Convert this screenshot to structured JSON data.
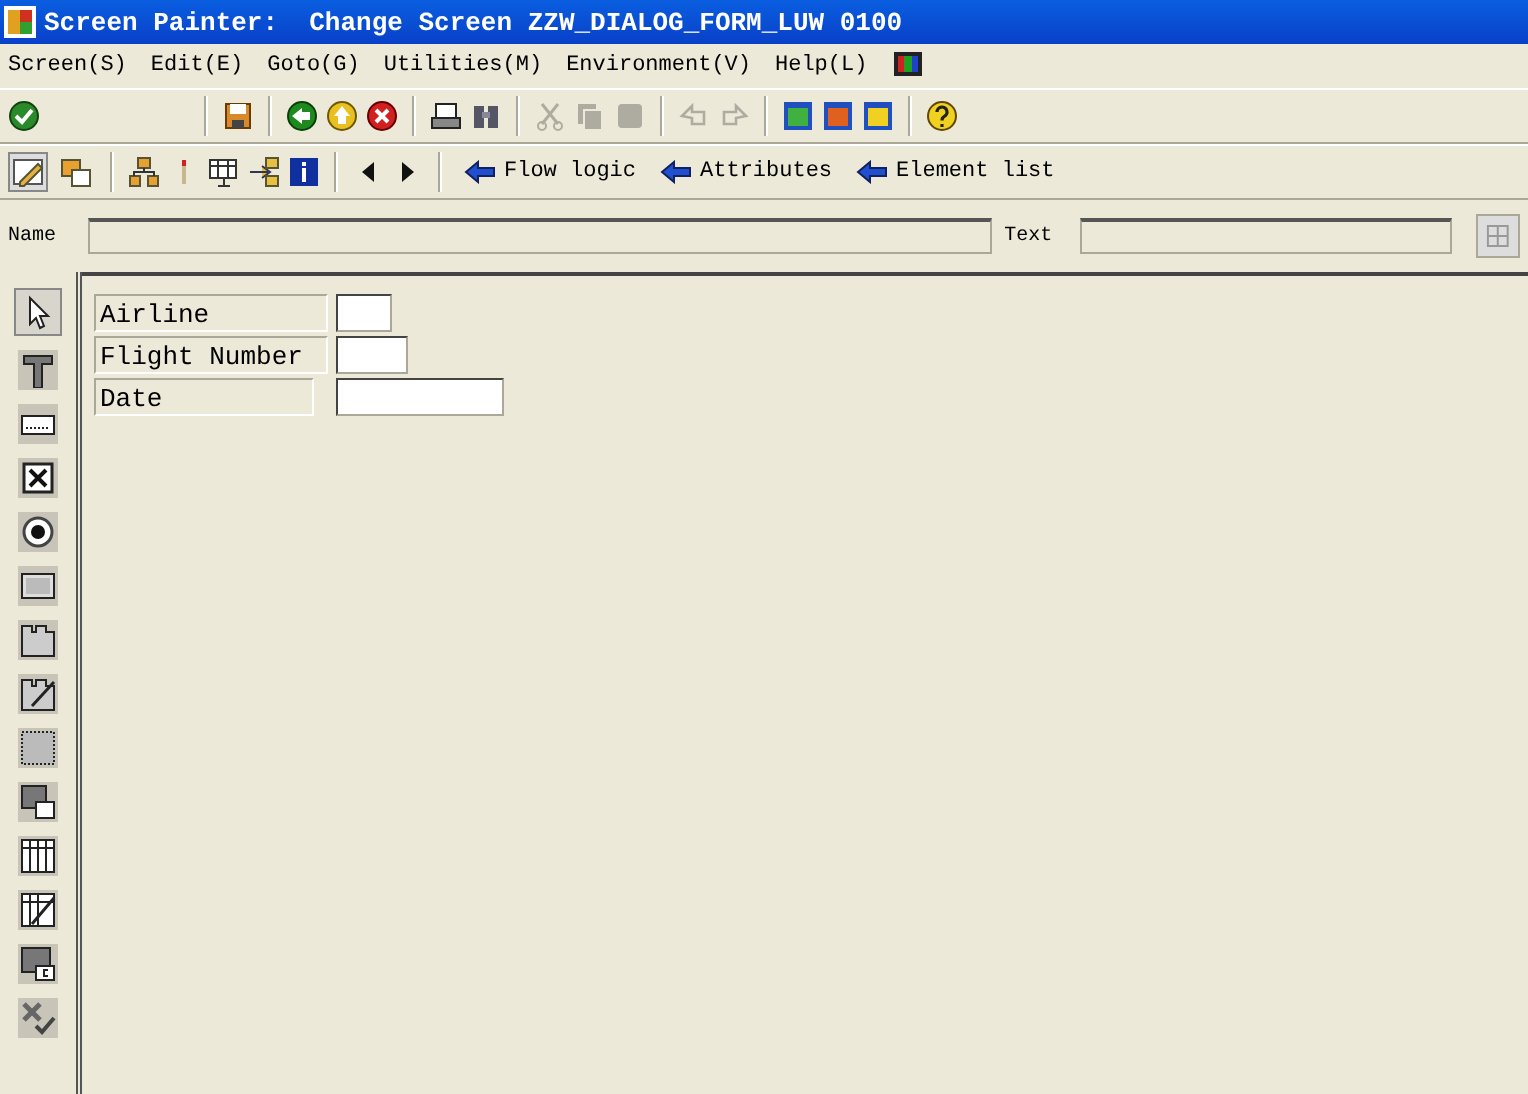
{
  "window": {
    "title": "Screen Painter:  Change Screen ZZW_DIALOG_FORM_LUW 0100"
  },
  "menu": [
    "Screen(S)",
    "Edit(E)",
    "Goto(G)",
    "Utilities(M)",
    "Environment(V)",
    "Help(L)"
  ],
  "toolbar": [
    {
      "kind": "check",
      "disabled": false
    },
    {
      "kind": "sep"
    },
    {
      "kind": "save",
      "disabled": false
    },
    {
      "kind": "sep"
    },
    {
      "kind": "back",
      "disabled": false
    },
    {
      "kind": "exit",
      "disabled": false
    },
    {
      "kind": "cancel",
      "disabled": false
    },
    {
      "kind": "sep"
    },
    {
      "kind": "print",
      "disabled": false
    },
    {
      "kind": "find",
      "disabled": false
    },
    {
      "kind": "sep"
    },
    {
      "kind": "cut",
      "disabled": true
    },
    {
      "kind": "copy",
      "disabled": true
    },
    {
      "kind": "paste",
      "disabled": true
    },
    {
      "kind": "sep"
    },
    {
      "kind": "undo",
      "disabled": true
    },
    {
      "kind": "redo",
      "disabled": true
    },
    {
      "kind": "sep"
    },
    {
      "kind": "win1",
      "disabled": false
    },
    {
      "kind": "win2",
      "disabled": false
    },
    {
      "kind": "win3",
      "disabled": false
    },
    {
      "kind": "sep"
    },
    {
      "kind": "help",
      "disabled": false
    }
  ],
  "app_toolbar": {
    "tools": [
      {
        "kind": "edit",
        "selected": true
      },
      {
        "kind": "layers",
        "selected": false
      }
    ],
    "icons": [
      {
        "kind": "tree"
      },
      {
        "kind": "pin"
      },
      {
        "kind": "grid"
      },
      {
        "kind": "arrows"
      },
      {
        "kind": "info"
      }
    ],
    "links": [
      "Flow logic",
      "Attributes",
      "Element list"
    ]
  },
  "name_row": {
    "name_label": "Name",
    "text_label": "Text"
  },
  "palette": [
    {
      "kind": "pointer",
      "selected": true
    },
    {
      "kind": "text",
      "selected": false
    },
    {
      "kind": "input",
      "selected": false
    },
    {
      "kind": "checkbox",
      "selected": false
    },
    {
      "kind": "radio",
      "selected": false
    },
    {
      "kind": "button",
      "selected": false
    },
    {
      "kind": "tabstrip",
      "selected": false
    },
    {
      "kind": "tabwizard",
      "selected": false
    },
    {
      "kind": "box",
      "selected": false
    },
    {
      "kind": "subscreen",
      "selected": false
    },
    {
      "kind": "table",
      "selected": false
    },
    {
      "kind": "tablewizard",
      "selected": false
    },
    {
      "kind": "custom",
      "selected": false
    },
    {
      "kind": "status",
      "selected": false
    }
  ],
  "form": [
    {
      "label": "Airline"
    },
    {
      "label": "Flight Number"
    },
    {
      "label": "Date"
    }
  ]
}
